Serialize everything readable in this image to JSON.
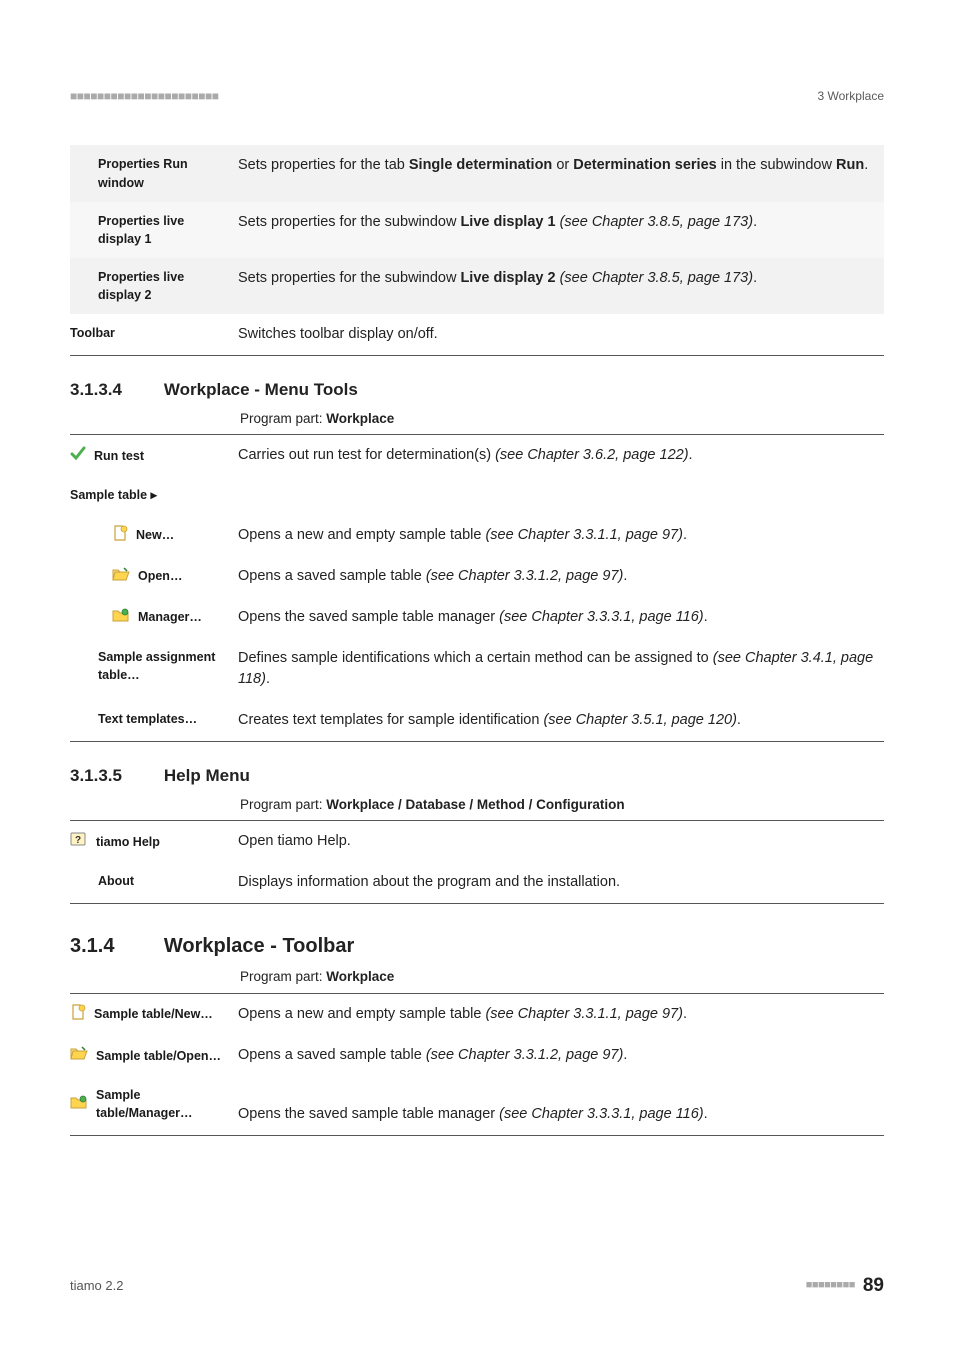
{
  "header": {
    "dashes": "■■■■■■■■■■■■■■■■■■■■■■",
    "chapter": "3 Workplace"
  },
  "table1": {
    "rows": [
      {
        "label": "Properties Run window",
        "desc_pre": "Sets properties for the tab ",
        "b1": "Single determination",
        "mid": " or ",
        "b2": "Determination series",
        "post": " in the subwindow ",
        "b3": "Run",
        "end": "."
      },
      {
        "label": "Properties live display 1",
        "desc_pre": "Sets properties for the subwindow ",
        "b1": "Live display 1",
        "it": " (see Chapter 3.8.5, page 173)",
        "end": "."
      },
      {
        "label": "Properties live display 2",
        "desc_pre": "Sets properties for the subwindow ",
        "b1": "Live display 2",
        "it": " (see Chapter 3.8.5, page 173)",
        "end": "."
      },
      {
        "label": "Toolbar",
        "desc": "Switches toolbar display on/off."
      }
    ]
  },
  "sec_3134": {
    "num": "3.1.3.4",
    "title": "Workplace - Menu Tools",
    "program_part_label": "Program part: ",
    "program_part": "Workplace"
  },
  "table2": {
    "run_test": {
      "label": "Run test",
      "desc_pre": "Carries out run test for determination(s) ",
      "it": "(see Chapter 3.6.2, page 122)",
      "end": "."
    },
    "sample_table": {
      "label": "Sample table ▸"
    },
    "new": {
      "label": "New…",
      "desc_pre": "Opens a new and empty sample table ",
      "it": "(see Chapter 3.3.1.1, page 97)",
      "end": "."
    },
    "open": {
      "label": "Open…",
      "desc_pre": "Opens a saved sample table ",
      "it": "(see Chapter 3.3.1.2, page 97)",
      "end": "."
    },
    "manager": {
      "label": "Manager…",
      "desc_pre": "Opens the saved sample table manager ",
      "it": "(see Chapter 3.3.3.1, page 116)",
      "end": "."
    },
    "assign": {
      "label": "Sample assignment table…",
      "desc_pre": "Defines sample identifications which a certain method can be assigned to ",
      "it": "(see Chapter 3.4.1, page 118)",
      "end": "."
    },
    "templates": {
      "label": "Text templates…",
      "desc_pre": "Creates text templates for sample identification ",
      "it": "(see Chapter 3.5.1, page 120)",
      "end": "."
    }
  },
  "sec_3135": {
    "num": "3.1.3.5",
    "title": "Help Menu",
    "program_part_label": "Program part: ",
    "program_part": "Workplace / Database / Method / Configuration"
  },
  "table3": {
    "help": {
      "label": "tiamo Help",
      "desc": "Open tiamo Help."
    },
    "about": {
      "label": "About",
      "desc": "Displays information about the program and the installation."
    }
  },
  "sec_314": {
    "num": "3.1.4",
    "title": "Workplace - Toolbar",
    "program_part_label": "Program part: ",
    "program_part": "Workplace"
  },
  "table4": {
    "new": {
      "label": "Sample table/New…",
      "desc_pre": "Opens a new and empty sample table ",
      "it": "(see Chapter 3.3.1.1, page 97)",
      "end": "."
    },
    "open": {
      "label": "Sample table/Open…",
      "desc_pre": "Opens a saved sample table ",
      "it": "(see Chapter 3.3.1.2, page 97)",
      "end": "."
    },
    "manager": {
      "label": "Sample table/Manager…",
      "desc_pre": "Opens the saved sample table manager ",
      "it": "(see Chapter 3.3.3.1, page 116)",
      "end": "."
    }
  },
  "footer": {
    "product": "tiamo 2.2",
    "dashes": "■■■■■■■■",
    "page": "89"
  }
}
